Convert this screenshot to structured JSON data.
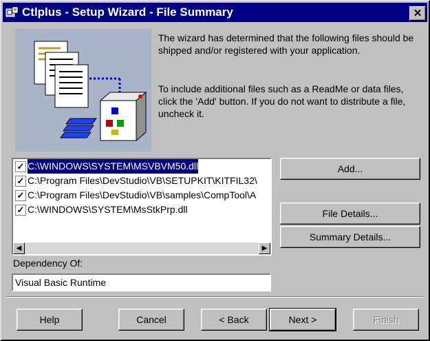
{
  "window": {
    "title": "Ctlplus - Setup Wizard - File Summary",
    "close_glyph": "✕",
    "colors": {
      "titlebar": "#000080",
      "face": "#c0c0c0",
      "selection": "#000080"
    }
  },
  "description": {
    "paragraph1": "The wizard has determined that the following files should be shipped and/or registered with your application.",
    "paragraph2": "To include additional files such as a ReadMe or data files, click the 'Add' button.  If you do not want to distribute a file, uncheck it."
  },
  "file_list": {
    "items": [
      {
        "path": "C:\\WINDOWS\\SYSTEM\\MSVBVM50.dll",
        "checked": true,
        "selected": true
      },
      {
        "path": "C:\\Program Files\\DevStudio\\VB\\SETUPKIT\\KITFIL32\\",
        "checked": true,
        "selected": false
      },
      {
        "path": "C:\\Program Files\\DevStudio\\VB\\samples\\CompTool\\A",
        "checked": true,
        "selected": false
      },
      {
        "path": "C:\\WINDOWS\\SYSTEM\\MsStkPrp.dll",
        "checked": true,
        "selected": false
      }
    ]
  },
  "side_buttons": {
    "add": "Add...",
    "file_details": "File Details...",
    "summary_details": "Summary Details..."
  },
  "dependency": {
    "label": "Dependency Of:",
    "value": "Visual Basic Runtime"
  },
  "footer_buttons": {
    "help": "Help",
    "cancel": "Cancel",
    "back": "< Back",
    "next": "Next >",
    "finish": "Finish"
  }
}
